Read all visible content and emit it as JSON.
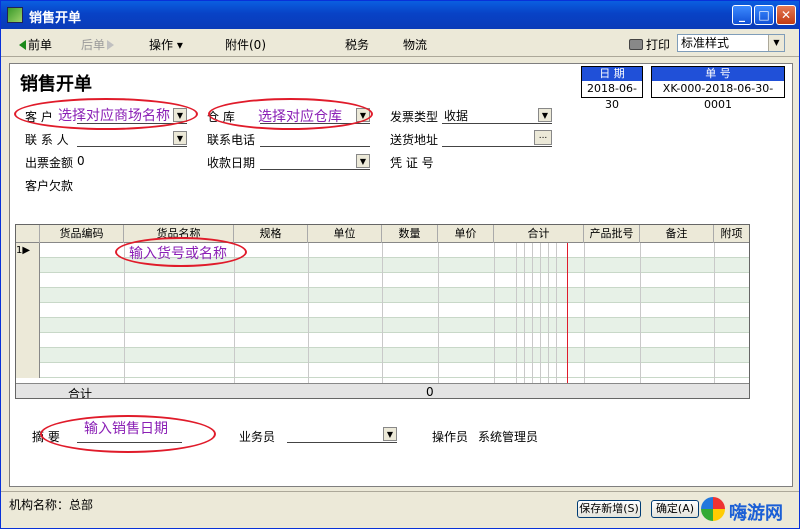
{
  "window": {
    "title": "销售开单"
  },
  "toolbar": {
    "prev": "前单",
    "next": "后单",
    "actions": "操作",
    "attachments": "附件(0)",
    "tax": "税务",
    "logistics": "物流",
    "print": "打印",
    "print_style": "标准样式"
  },
  "form": {
    "title": "销售开单",
    "date_header": "日 期",
    "date_value": "2018-06-30",
    "number_header": "单 号",
    "number_value": "XK-000-2018-06-30-0001",
    "labels": {
      "customer": "客    户",
      "warehouse": "仓    库",
      "invoice_type": "发票类型",
      "contact": "联 系 人",
      "phone": "联系电话",
      "delivery_address": "送货地址",
      "invoice_amount": "出票金额",
      "payment_date": "收款日期",
      "voucher_no": "凭 证 号",
      "customer_debt": "客户欠款",
      "summary": "摘    要",
      "salesperson": "业务员",
      "operator": "操作员"
    },
    "values": {
      "invoice_type": "收据",
      "invoice_amount": "0",
      "operator": "系统管理员"
    }
  },
  "annotations": {
    "customer": "选择对应商场名称",
    "warehouse": "选择对应仓库",
    "goods": "输入货号或名称",
    "date": "输入销售日期"
  },
  "grid": {
    "columns": [
      "货品编码",
      "货品名称",
      "规格",
      "单位",
      "数量",
      "单价",
      "合计",
      "产品批号",
      "备注",
      "附项"
    ],
    "first_row_marker": "1▶",
    "total_label": "合计",
    "total_qty": "0"
  },
  "status": {
    "org_label": "机构名称：总部",
    "save_new": "保存新增(S)",
    "confirm": "确定(A)",
    "logo": "嗨游网"
  }
}
